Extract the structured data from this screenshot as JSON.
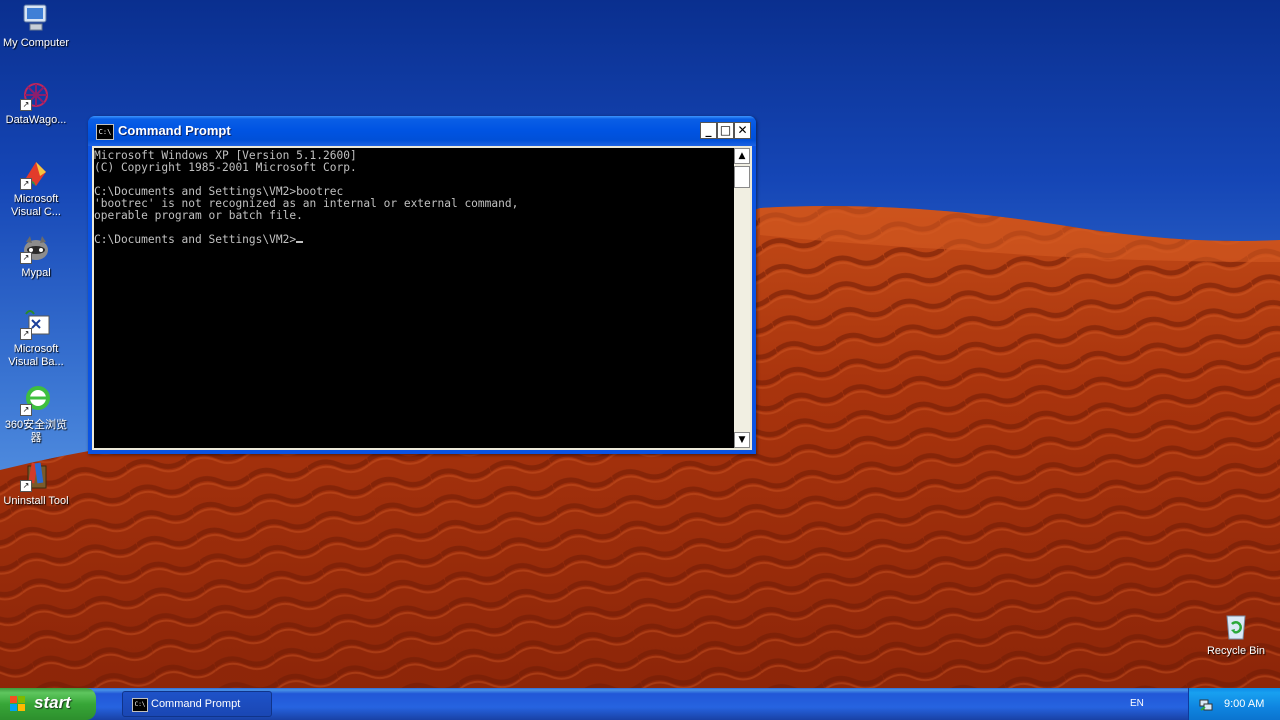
{
  "desktop": {
    "icons": [
      {
        "label": "My Computer",
        "icon": "my-computer-icon"
      },
      {
        "label": "DataWago...",
        "icon": "datawago-icon"
      },
      {
        "label": "Microsoft Visual C...",
        "icon": "visual-cpp-icon"
      },
      {
        "label": "Mypal",
        "icon": "mypal-icon"
      },
      {
        "label": "Microsoft Visual Ba...",
        "icon": "visual-basic-icon"
      },
      {
        "label": "360安全浏览器",
        "icon": "360-browser-icon"
      },
      {
        "label": "Uninstall Tool",
        "icon": "uninstall-tool-icon"
      },
      {
        "label": "Recycle Bin",
        "icon": "recycle-bin-icon"
      }
    ]
  },
  "window": {
    "title": "Command Prompt",
    "icon_text": "C:\\",
    "minimize": "_",
    "maximize": "□",
    "close": "✕",
    "console_lines": [
      "Microsoft Windows XP [Version 5.1.2600]",
      "(C) Copyright 1985-2001 Microsoft Corp.",
      "",
      "C:\\Documents and Settings\\VM2>bootrec",
      "'bootrec' is not recognized as an internal or external command,",
      "operable program or batch file.",
      "",
      "C:\\Documents and Settings\\VM2>"
    ]
  },
  "taskbar": {
    "start_label": "start",
    "task_label": "Command Prompt",
    "language": "EN",
    "clock": "9:00 AM"
  },
  "colors": {
    "xp_blue": "#0054e3",
    "start_green": "#37a637",
    "console_bg": "#000000",
    "console_fg": "#c0c0c0",
    "dune_red": "#b5370f"
  }
}
